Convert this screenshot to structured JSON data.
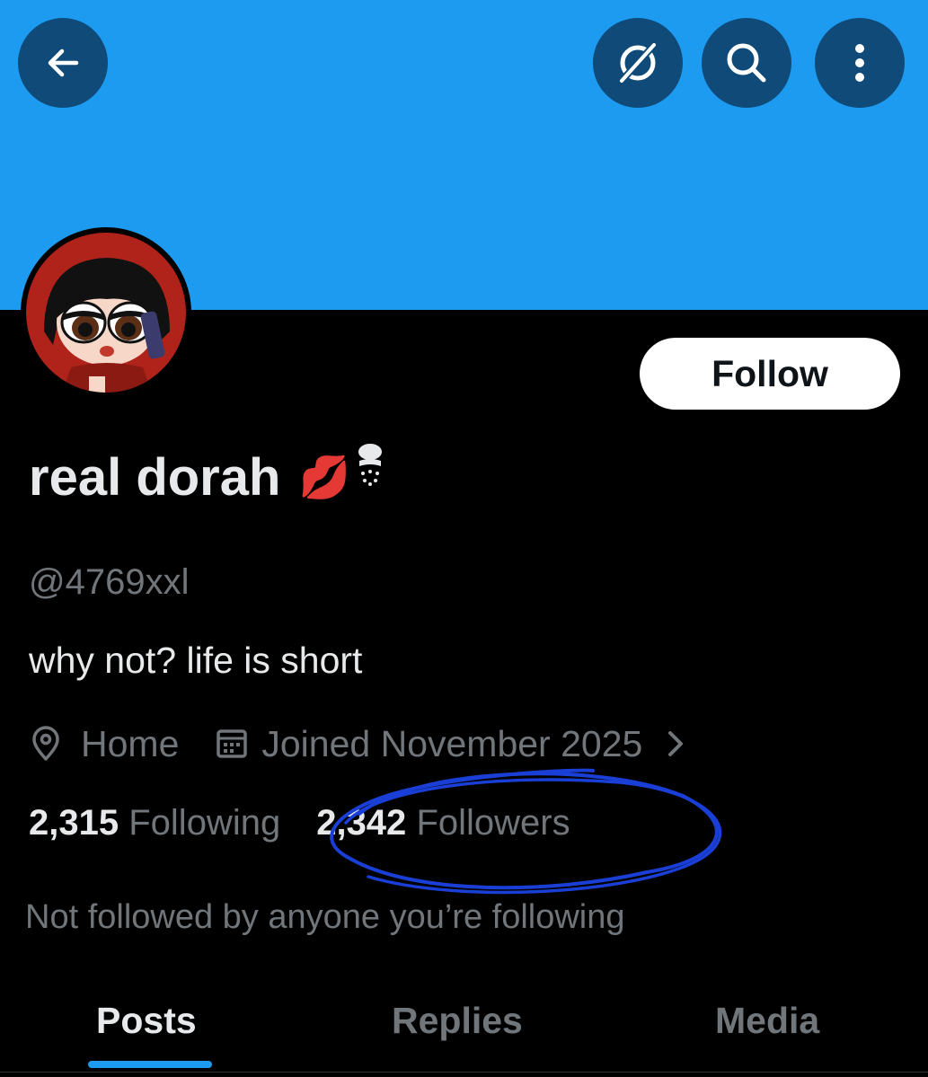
{
  "profile": {
    "display_name": "real dorah",
    "name_emoji": "💋",
    "handle": "@4769xxl",
    "bio": "why not? life is short",
    "location": "Home",
    "joined": "Joined November 2025",
    "following_count": "2,315",
    "following_label": "Following",
    "followers_count": "2,342",
    "followers_label": "Followers",
    "not_followed_text": "Not followed by anyone you’re following"
  },
  "header": {
    "back_icon": "arrow-left-icon",
    "grok_icon": "grok-icon",
    "search_icon": "search-icon",
    "more_icon": "more-vertical-icon"
  },
  "actions": {
    "follow_label": "Follow"
  },
  "tabs": [
    {
      "label": "Posts",
      "active": true
    },
    {
      "label": "Replies",
      "active": false
    },
    {
      "label": "Media",
      "active": false
    }
  ],
  "colors": {
    "banner": "#1d9bf0",
    "accent": "#1d9bf0",
    "annotation": "#1a3fd6",
    "background": "#000000"
  }
}
